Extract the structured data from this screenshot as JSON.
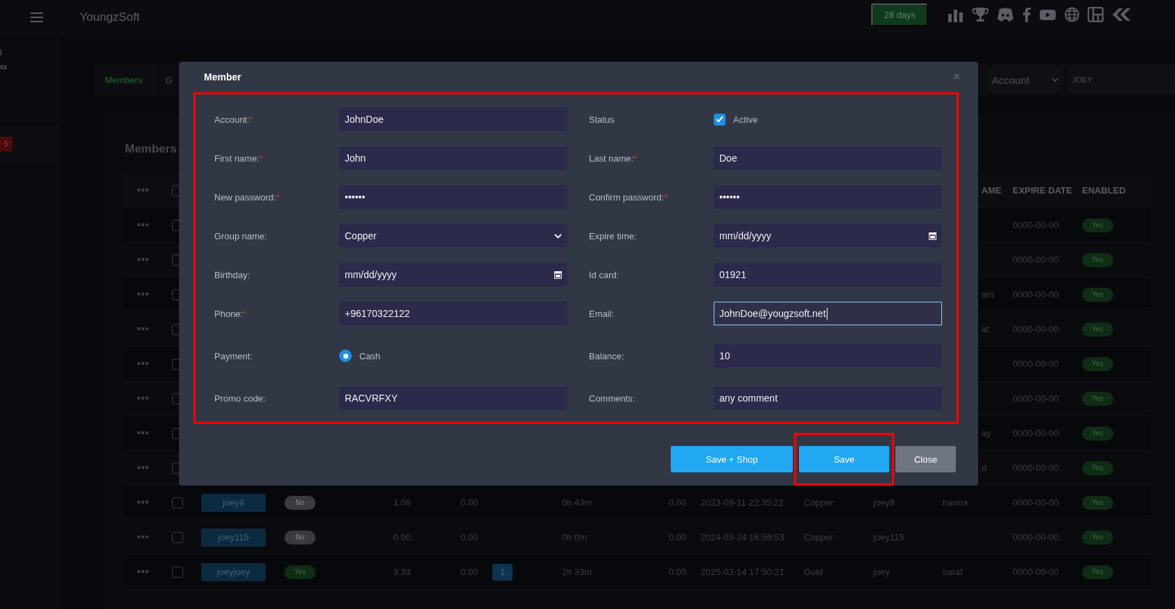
{
  "topbar": {
    "brand": "YoungzSoft",
    "trial_badge": "28 days"
  },
  "sidebar": {
    "user_name": "l",
    "user_sub": "xx",
    "badge": "5"
  },
  "tabs": [
    {
      "label": "Members",
      "selected": true
    },
    {
      "label": "G",
      "selected": false
    }
  ],
  "filter": {
    "field": "Account",
    "search": "JOEY"
  },
  "heading": "Members",
  "table": {
    "select_all_checked": false,
    "columns": [
      "AME",
      "EXPIRE DATE",
      "ENABLED"
    ],
    "rows": [
      {
        "kind": "covered",
        "checked": false,
        "expire": "0000-00-00",
        "enabled": {
          "label": "Yes",
          "on": true
        }
      },
      {
        "kind": "covered",
        "checked": false,
        "expire": "0000-00-00",
        "enabled": {
          "label": "Yes",
          "on": true
        }
      },
      {
        "kind": "covered",
        "checked": false,
        "name": "am",
        "expire": "0000-00-00",
        "enabled": {
          "label": "Yes",
          "on": true
        }
      },
      {
        "kind": "covered",
        "checked": false,
        "name": "af",
        "expire": "0000-00-00",
        "enabled": {
          "label": "Yes",
          "on": true
        }
      },
      {
        "kind": "covered",
        "checked": false,
        "expire": "0000-00-00",
        "enabled": {
          "label": "Yes",
          "on": true
        }
      },
      {
        "kind": "covered",
        "checked": false,
        "expire": "0000-00-00",
        "enabled": {
          "label": "Yes",
          "on": true
        }
      },
      {
        "kind": "covered",
        "checked": false,
        "name": "ay",
        "expire": "0000-00-00",
        "enabled": {
          "label": "Yes",
          "on": true
        }
      },
      {
        "kind": "covered",
        "checked": false,
        "name": "d",
        "expire": "0000-00-00",
        "enabled": {
          "label": "Yes",
          "on": true
        }
      },
      {
        "kind": "full",
        "checked": false,
        "user": "joey8",
        "online": {
          "label": "No",
          "on": false
        },
        "balance": "1.09",
        "column_6": "0.00",
        "time": "0h 43m",
        "column_9": "0.00",
        "date": "2023-09-11 22:35:22",
        "group": "Copper",
        "nick": "joey8",
        "name": "hanna",
        "expire": "0000-00-00",
        "enabled": {
          "label": "Yes",
          "on": true
        }
      },
      {
        "kind": "full",
        "checked": false,
        "user": "joey115",
        "online": {
          "label": "No",
          "on": false
        },
        "balance": "0.00",
        "column_6": "0.00",
        "time": "0h 0m",
        "column_9": "0.00",
        "date": "2024-03-24 16:59:53",
        "group": "Copper",
        "nick": "joey115",
        "expire": "0000-00-00",
        "enabled": {
          "label": "Yes",
          "on": true
        }
      },
      {
        "kind": "full",
        "checked": false,
        "user": "joeyjoey",
        "online": {
          "label": "Yes",
          "on": true
        },
        "balance": "3.33",
        "column_6": "0.00",
        "count": "1",
        "time": "2h 33m",
        "column_9": "0.00",
        "date": "2025-03-14 17:50:21",
        "group": "Gold",
        "nick": "joey",
        "name": "saraf",
        "expire": "0000-00-00",
        "enabled": {
          "label": "Yes",
          "on": true
        }
      }
    ]
  },
  "modal": {
    "title": "Member",
    "close": "×",
    "highlight": true,
    "fields": [
      {
        "label": "Account:",
        "mark": "*",
        "kind": "text",
        "value": "JohnDoe",
        "focused": false
      },
      {
        "label": "Status",
        "kind": "checkbox",
        "checked": true,
        "text": "Active"
      },
      {
        "label": "First name:",
        "mark": "*",
        "kind": "text",
        "value": "John",
        "focused": false
      },
      {
        "label": "Last name:",
        "mark": "*",
        "kind": "text",
        "value": "Doe",
        "focused": false
      },
      {
        "label": "New password:",
        "mark": "*",
        "kind": "password",
        "value": "••••••"
      },
      {
        "label": "Confirm password:",
        "mark": "*",
        "kind": "password",
        "value": "••••••"
      },
      {
        "label": "Group name:",
        "kind": "select",
        "value": "Copper"
      },
      {
        "label": "Expire time:",
        "kind": "date",
        "placeholder": "mm/dd/yyyy"
      },
      {
        "label": "Birthday:",
        "kind": "date",
        "placeholder": "mm/dd/yyyy"
      },
      {
        "label": "Id card:",
        "kind": "text",
        "value": "01921",
        "focused": false
      },
      {
        "label": "Phone:",
        "mark": "*",
        "kind": "text",
        "value": "+96170322122",
        "focused": false
      },
      {
        "label": "Email:",
        "kind": "text",
        "value": "JohnDoe@yougzsoft.net",
        "focused": true
      },
      {
        "label": "Payment:",
        "kind": "radio",
        "options": [
          {
            "text": "Cash",
            "selected": true
          }
        ]
      },
      {
        "label": "Balance:",
        "kind": "text",
        "value": "10",
        "focused": false
      },
      {
        "label": "Promo code:",
        "kind": "text",
        "value": "RACVRFXY",
        "focused": false
      },
      {
        "label": "Comments:",
        "kind": "text",
        "value": "any comment",
        "focused": false
      }
    ],
    "buttons": [
      {
        "label": "Save + Shop",
        "kind": "primary",
        "highlight": false
      },
      {
        "label": "Save",
        "kind": "primary",
        "highlight": true
      },
      {
        "label": "Close",
        "kind": "secondary",
        "highlight": false
      }
    ]
  }
}
